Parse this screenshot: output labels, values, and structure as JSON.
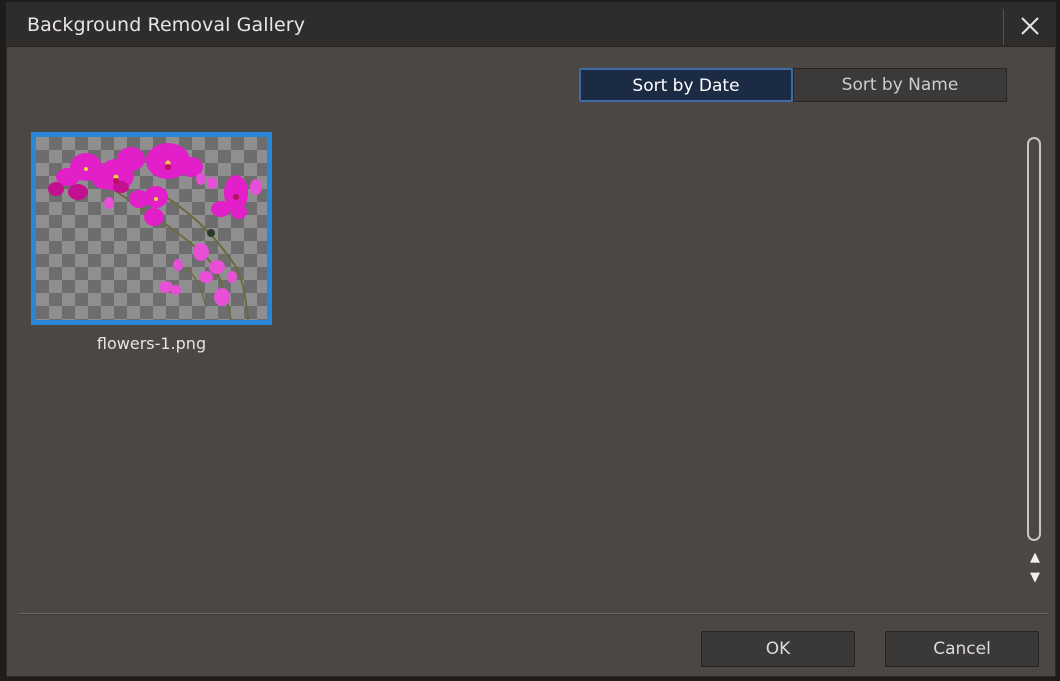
{
  "dialog": {
    "title": "Background Removal Gallery",
    "close_icon": "close-icon"
  },
  "sort": {
    "by_date_label": "Sort by Date",
    "by_name_label": "Sort by Name",
    "selected": "Sort by Date"
  },
  "gallery": {
    "items": [
      {
        "filename": "flowers-1.png",
        "thumbnail": "orchid-transparent-background",
        "selected": true
      }
    ]
  },
  "scrollbar": {
    "up_icon": "arrow-up-icon",
    "down_icon": "arrow-down-icon"
  },
  "footer": {
    "ok_label": "OK",
    "cancel_label": "Cancel"
  },
  "colors": {
    "selection_border": "#2a86d6",
    "active_sort_bg": "#1c2b44",
    "dialog_bg": "#4a4745",
    "titlebar_bg": "#2f2d2c"
  }
}
